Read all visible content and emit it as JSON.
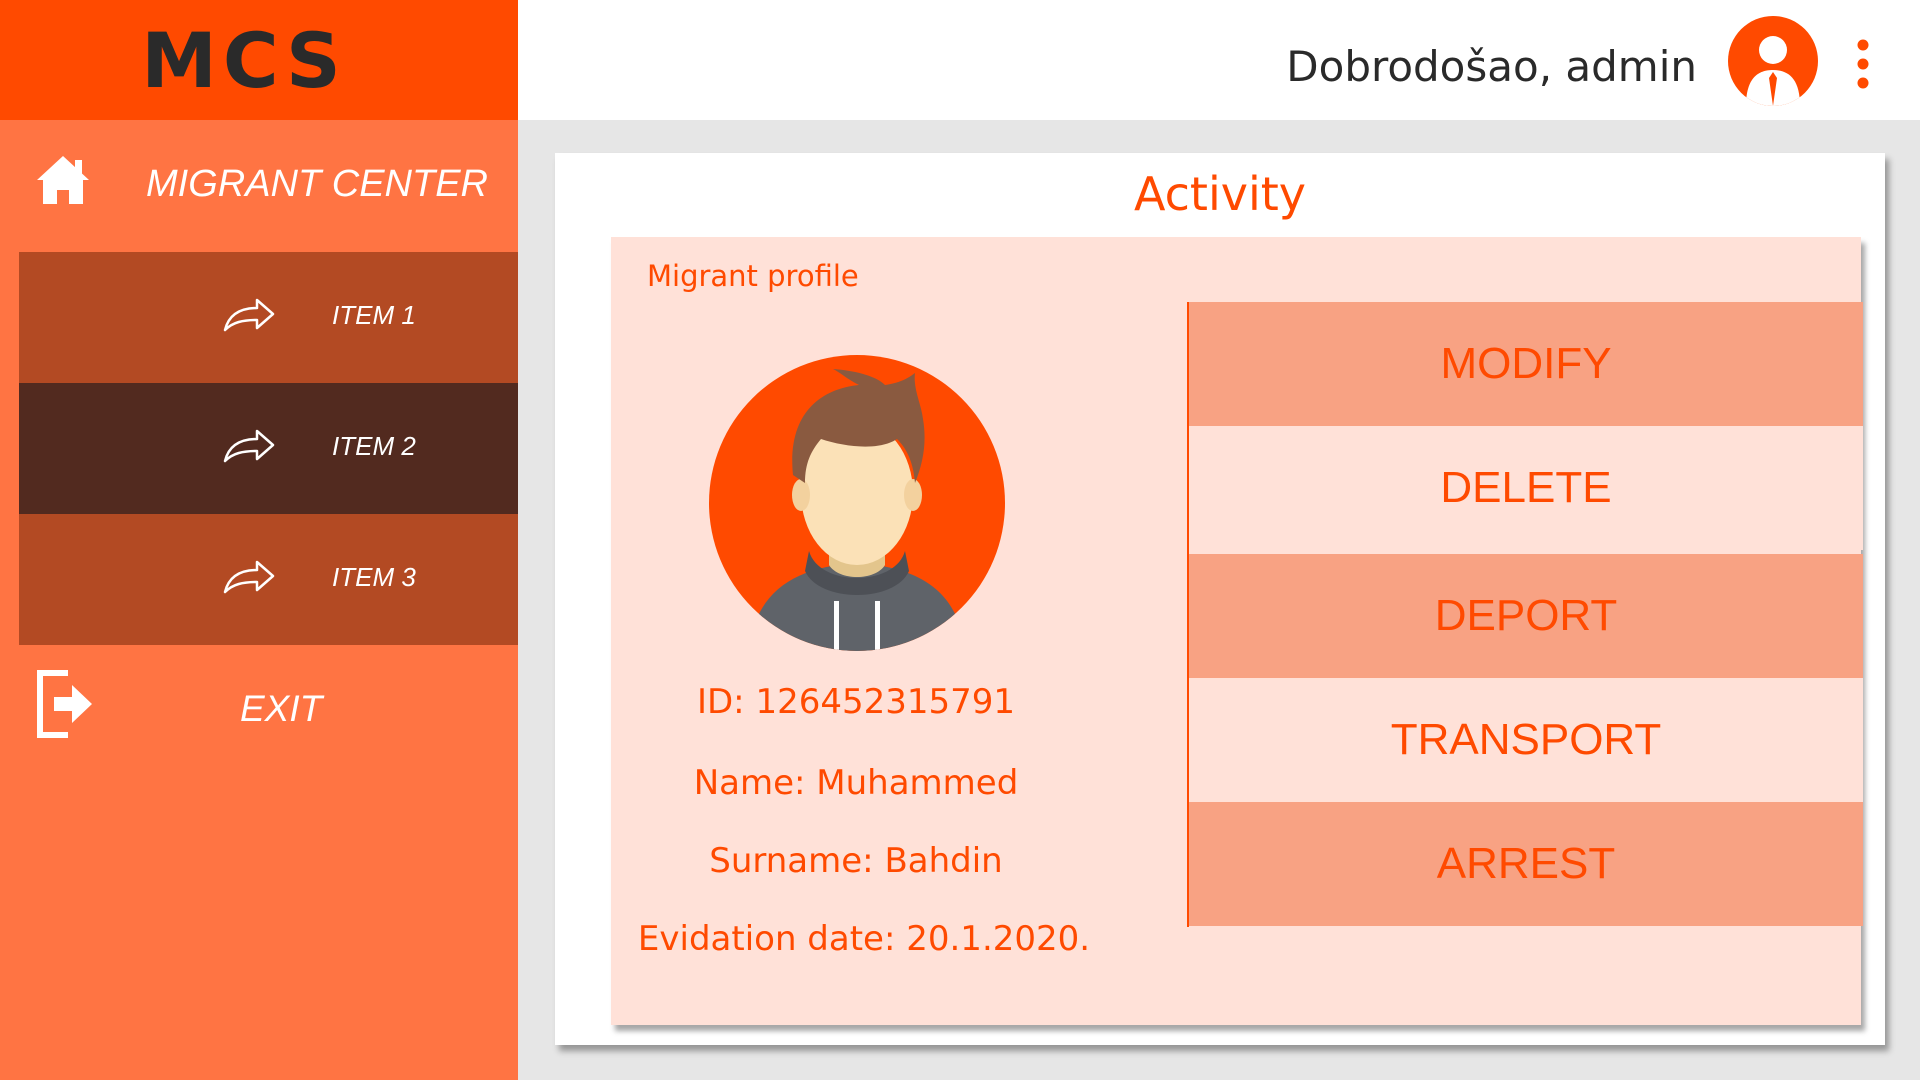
{
  "app": {
    "brand": "MCS"
  },
  "sidebar": {
    "home_label": "MIGRANT CENTER",
    "items": [
      {
        "label": "ITEM 1",
        "bg": "#b34a23"
      },
      {
        "label": "ITEM 2",
        "bg": "#522a1f"
      },
      {
        "label": "ITEM 3",
        "bg": "#b34a23"
      }
    ],
    "exit_label": "EXIT"
  },
  "header": {
    "welcome": "Dobrodošao, admin"
  },
  "main": {
    "title": "Activity",
    "section_label": "Migrant profile",
    "profile": {
      "id": "ID: 126452315791",
      "name": "Name: Muhammed",
      "surname": "Surname: Bahdin",
      "date": "Evidation date: 20.1.2020."
    },
    "actions": [
      "MODIFY",
      "DELETE",
      "DEPORT",
      "TRANSPORT",
      "ARREST"
    ]
  },
  "colors": {
    "accent": "#ff4a00",
    "sidebar": "#ff7443",
    "panel": "#ffe1d8",
    "button_dark": "#f8a283"
  },
  "icons": [
    "home-icon",
    "share-arrow-icon",
    "exit-icon",
    "user-avatar-icon",
    "kebab-menu-icon"
  ]
}
